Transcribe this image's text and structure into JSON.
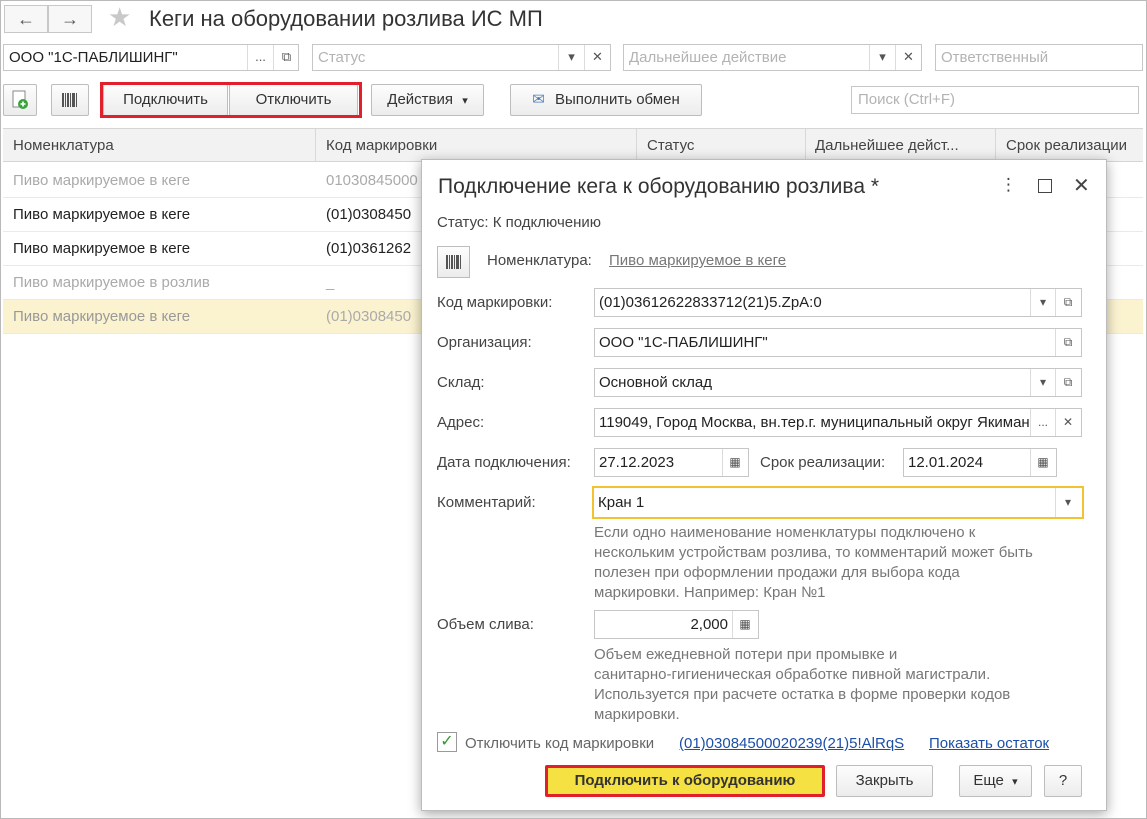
{
  "window": {
    "title": "Кеги на оборудовании розлива ИС МП",
    "back_glyph": "←",
    "forward_glyph": "→",
    "star_glyph": "★"
  },
  "filters": {
    "organization_value": "ООО \"1С-ПАБЛИШИНГ\"",
    "status_placeholder": "Статус",
    "next_action_placeholder": "Дальнейшее действие",
    "responsible_placeholder": "Ответственный"
  },
  "toolbar": {
    "connect_label": "Подключить",
    "disconnect_label": "Отключить",
    "actions_label": "Действия",
    "exchange_label": "Выполнить обмен",
    "search_placeholder": "Поиск (Ctrl+F)"
  },
  "table": {
    "columns": [
      "Номенклатура",
      "Код маркировки",
      "Статус",
      "Дальнейшее дейст...",
      "Срок реализации"
    ],
    "rows": [
      {
        "name": "Пиво маркируемое в кеге",
        "code": "01030845000"
      },
      {
        "name": "Пиво маркируемое в кеге",
        "code": "(01)0308450"
      },
      {
        "name": "Пиво маркируемое в кеге",
        "code": "(01)0361262"
      },
      {
        "name": "Пиво маркируемое в розлив",
        "code": "_"
      },
      {
        "name": "Пиво маркируемое в кеге",
        "code": "(01)0308450"
      }
    ]
  },
  "dialog": {
    "title": "Подключение кега к оборудованию розлива *",
    "status_text": "Статус: К подключению",
    "nomenclature_label": "Номенклатура:",
    "nomenclature_value": "Пиво маркируемое в кеге",
    "code_label": "Код маркировки:",
    "code_value": "(01)03612622833712(21)5.ZpA:0",
    "org_label": "Организация:",
    "org_value": "ООО \"1С-ПАБЛИШИНГ\"",
    "warehouse_label": "Склад:",
    "warehouse_value": "Основной склад",
    "address_label": "Адрес:",
    "address_value": "119049, Город Москва, вн.тер.г. муниципальный округ Якиманка",
    "conn_date_label": "Дата подключения:",
    "conn_date_value": "27.12.2023",
    "expiry_label": "Срок реализации:",
    "expiry_value": "12.01.2024",
    "comment_label": "Комментарий:",
    "comment_value": "Кран 1",
    "comment_hint": [
      "Если одно наименование номенклатуры подключено к",
      "нескольким устройствам розлива, то комментарий может быть",
      "полезен при оформлении продажи для выбора кода",
      "маркировки. Например: Кран №1"
    ],
    "volume_label": "Объем слива:",
    "volume_value": "2,000",
    "volume_hint": [
      "Объем ежедневной потери при промывке и",
      "санитарно-гигиеническая обработке пивной магистрали.",
      "Используется при расчете остатка в форме проверки кодов",
      "маркировки."
    ],
    "disconnect_code_label": "Отключить код маркировки",
    "disconnect_code_link": "(01)03084500020239(21)5!AlRqS",
    "show_remainder_link": "Показать остаток",
    "connect_button": "Подключить к оборудованию",
    "close_button": "Закрыть",
    "more_button": "Еще",
    "help_button": "?"
  }
}
